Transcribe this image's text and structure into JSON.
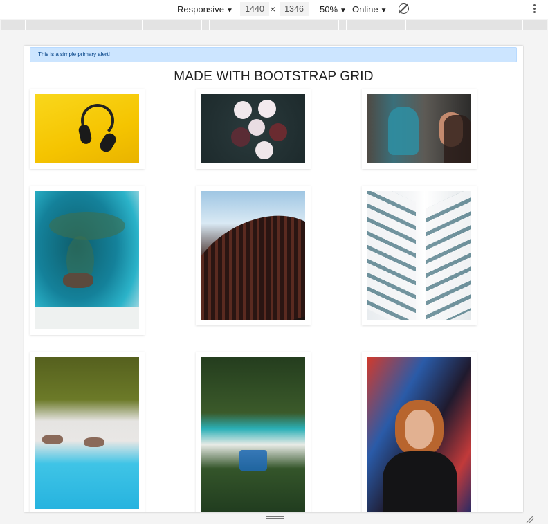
{
  "devtools_toolbar": {
    "device_mode": "Responsive",
    "width_value": "1440",
    "dimension_separator": "×",
    "height_value": "1346",
    "zoom": "50%",
    "throttling": "Online",
    "rotate_icon": "rotate-icon",
    "menu_icon": "kebab-icon"
  },
  "page": {
    "alert_text": "This is a simple primary alert!",
    "title": "MADE WITH BOOTSTRAP GRID",
    "images": [
      {
        "subject": "headphones"
      },
      {
        "subject": "cupcakes"
      },
      {
        "subject": "graffiti"
      },
      {
        "subject": "sea-aerial"
      },
      {
        "subject": "curved-building"
      },
      {
        "subject": "white-building"
      },
      {
        "subject": "beach-aerial"
      },
      {
        "subject": "palm-beach"
      },
      {
        "subject": "portrait"
      }
    ]
  },
  "colors": {
    "alert_bg": "#cce5ff",
    "alert_text": "#004085",
    "viewport_bg": "#ffffff",
    "chrome_bg": "#f4f4f4"
  }
}
